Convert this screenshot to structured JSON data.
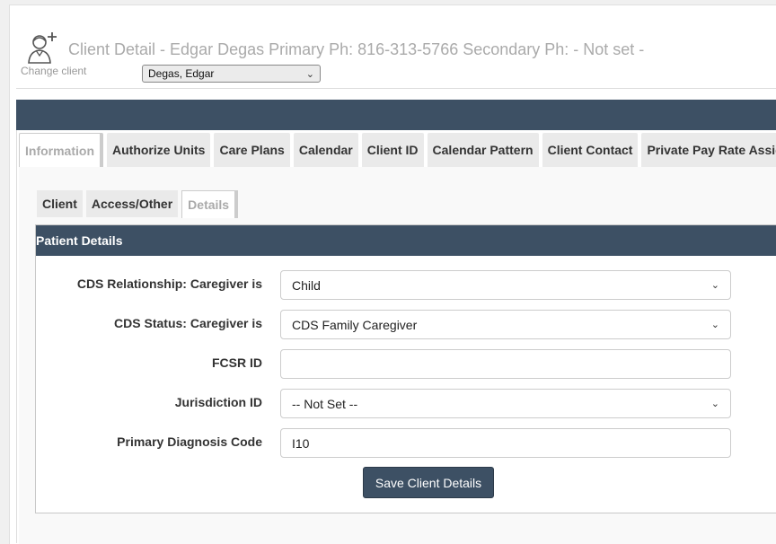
{
  "header": {
    "title": "Client Detail - Edgar Degas Primary Ph: 816-313-5766 Secondary Ph: - Not set -",
    "change_client_label": "Change client",
    "client_selected": "Degas, Edgar",
    "icon": "client-add-icon"
  },
  "tabs": [
    {
      "label": "Information",
      "active": true
    },
    {
      "label": "Authorize Units"
    },
    {
      "label": "Care Plans"
    },
    {
      "label": "Calendar"
    },
    {
      "label": "Client ID"
    },
    {
      "label": "Calendar Pattern"
    },
    {
      "label": "Client Contact"
    },
    {
      "label": "Private Pay Rate Assignm"
    }
  ],
  "subtabs": [
    {
      "label": "Client"
    },
    {
      "label": "Access/Other"
    },
    {
      "label": "Details",
      "active": true
    }
  ],
  "panel": {
    "title": "Patient Details",
    "fields": [
      {
        "label": "CDS Relationship: Caregiver is",
        "value": "Child",
        "type": "select"
      },
      {
        "label": "CDS Status: Caregiver is",
        "value": "CDS Family Caregiver",
        "type": "select"
      },
      {
        "label": "FCSR ID",
        "value": "",
        "type": "text"
      },
      {
        "label": "Jurisdiction ID",
        "value": "-- Not Set --",
        "type": "select"
      },
      {
        "label": "Primary Diagnosis Code",
        "value": "I10",
        "type": "text"
      }
    ],
    "save_label": "Save Client Details"
  },
  "colors": {
    "header_bar": "#3d5064",
    "muted_text": "#aaaaaa"
  }
}
